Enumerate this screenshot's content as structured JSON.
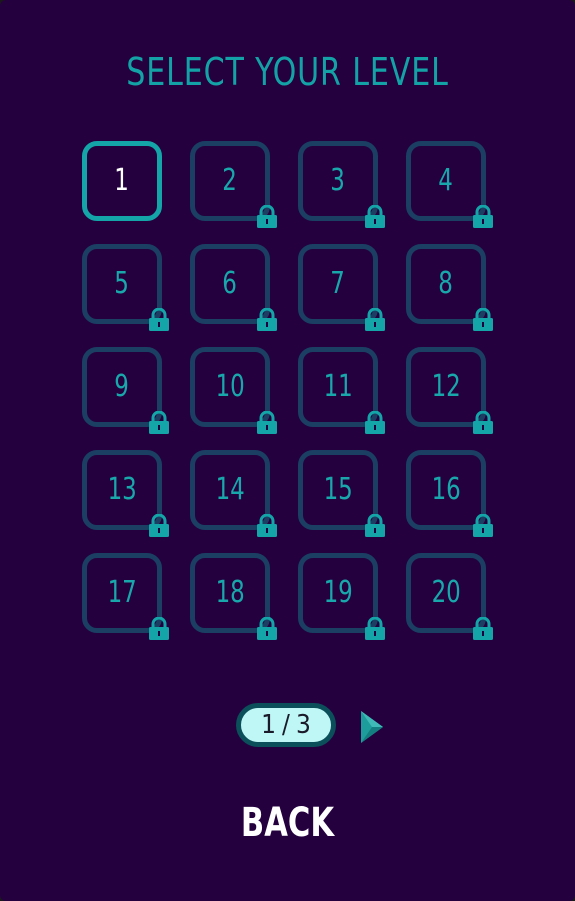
{
  "title": "SELECT YOUR LEVEL",
  "levels": [
    {
      "number": "1",
      "locked": false
    },
    {
      "number": "2",
      "locked": true
    },
    {
      "number": "3",
      "locked": true
    },
    {
      "number": "4",
      "locked": true
    },
    {
      "number": "5",
      "locked": true
    },
    {
      "number": "6",
      "locked": true
    },
    {
      "number": "7",
      "locked": true
    },
    {
      "number": "8",
      "locked": true
    },
    {
      "number": "9",
      "locked": true
    },
    {
      "number": "10",
      "locked": true
    },
    {
      "number": "11",
      "locked": true
    },
    {
      "number": "12",
      "locked": true
    },
    {
      "number": "13",
      "locked": true
    },
    {
      "number": "14",
      "locked": true
    },
    {
      "number": "15",
      "locked": true
    },
    {
      "number": "16",
      "locked": true
    },
    {
      "number": "17",
      "locked": true
    },
    {
      "number": "18",
      "locked": true
    },
    {
      "number": "19",
      "locked": true
    },
    {
      "number": "20",
      "locked": true
    }
  ],
  "pagination": {
    "current": "1",
    "separator": "/",
    "total": "3"
  },
  "icons": {
    "lock": "lock-icon",
    "next": "next-page-arrow-icon"
  },
  "back_label": "BACK",
  "colors": {
    "background": "#24003f",
    "accent": "#14a5a9",
    "locked_border": "#1a3f63",
    "pager_fill": "#bff7f6"
  }
}
